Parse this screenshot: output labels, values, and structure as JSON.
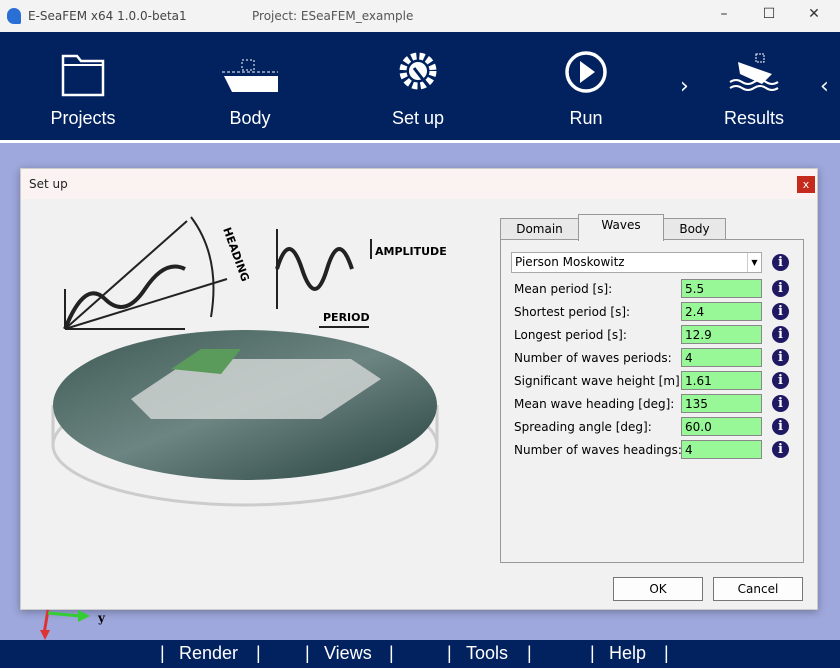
{
  "window": {
    "app_title": "E-SeaFEM x64 1.0.0-beta1",
    "project_title": "Project: ESeaFEM_example"
  },
  "nav": {
    "items": [
      {
        "label": "Projects",
        "icon": "folder-icon"
      },
      {
        "label": "Body",
        "icon": "ship-icon"
      },
      {
        "label": "Set up",
        "icon": "gear-wrench-icon"
      },
      {
        "label": "Run",
        "icon": "play-icon"
      },
      {
        "label": "Results",
        "icon": "ship-waves-icon"
      }
    ],
    "next": "›",
    "prev": "‹"
  },
  "dialog": {
    "title": "Set up",
    "close": "x",
    "illustration": {
      "heading_label": "HEADING",
      "amplitude_label": "AMPLITUDE",
      "period_label": "PERIOD"
    },
    "tabs": [
      {
        "label": "Domain"
      },
      {
        "label": "Waves",
        "active": true
      },
      {
        "label": "Body"
      }
    ],
    "spectrum": "Pierson Moskowitz",
    "fields": [
      {
        "label": "Mean period [s]:",
        "value": "5.5"
      },
      {
        "label": "Shortest period [s]:",
        "value": "2.4"
      },
      {
        "label": "Longest period [s]:",
        "value": "12.9"
      },
      {
        "label": "Number of waves periods:",
        "value": "4"
      },
      {
        "label": "Significant wave height [m]:",
        "value": "1.61"
      },
      {
        "label": "Mean wave heading [deg]:",
        "value": "135"
      },
      {
        "label": "Spreading angle [deg]:",
        "value": "60.0"
      },
      {
        "label": "Number of waves headings:",
        "value": "4"
      }
    ],
    "ok": "OK",
    "cancel": "Cancel"
  },
  "axis_label": "y",
  "bottom_menu": [
    "Render",
    "Views",
    "Tools",
    "Help"
  ],
  "colors": {
    "nav": "#01215f",
    "field": "#98f898",
    "background": "#9ea8dc",
    "info": "#1f1862"
  }
}
